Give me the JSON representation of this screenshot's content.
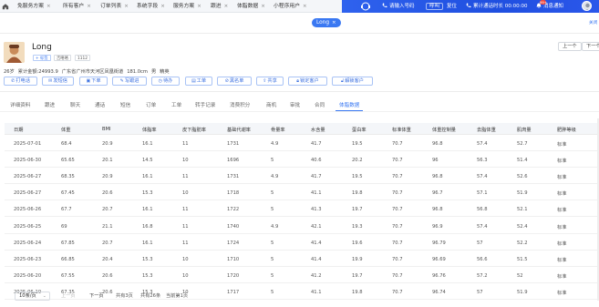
{
  "tabs": [
    {
      "label": "免服务方案"
    },
    {
      "label": "所有客户"
    },
    {
      "label": "订单列表"
    },
    {
      "label": "系统字段"
    },
    {
      "label": "服务方案"
    },
    {
      "label": "跟进"
    },
    {
      "label": "体脂数据"
    },
    {
      "label": "小程序用户"
    },
    {
      "label": "Long"
    }
  ],
  "tab_close": "×",
  "header": {
    "phone_label": "请输入号码",
    "dial_label": "呼叫",
    "reset_label": "复位",
    "call_duration": "累计通话时长 00:00:00",
    "messages_label": "消息通知",
    "message_count": "99+",
    "more_label": "关闭"
  },
  "customer": {
    "name": "Long",
    "tag_add": "+ 标签",
    "tag_1": "吉咯咯",
    "tag_2": "1112",
    "age": "26岁",
    "spent": "累计金额:24993.9",
    "address": "广东省广州市天河区凤凰街道",
    "height": "181.0cm",
    "gender": "男",
    "type": "精英"
  },
  "nav": {
    "prev": "上一个",
    "next": "下一个"
  },
  "actions": [
    {
      "label": "打电话",
      "icon": "phone-icon"
    },
    {
      "label": "发短信",
      "icon": "message-icon"
    },
    {
      "label": "下单",
      "icon": "cart-icon"
    },
    {
      "label": "写跟进",
      "icon": "edit-icon"
    },
    {
      "label": "待办",
      "icon": "todo-icon"
    },
    {
      "label": "工单",
      "icon": "ticket-icon"
    },
    {
      "label": "黑名单",
      "icon": "blacklist-icon"
    },
    {
      "label": "共享",
      "icon": "share-icon"
    },
    {
      "label": "锁定客户",
      "icon": "lock-icon"
    },
    {
      "label": "解锁客户",
      "icon": "unlock-icon"
    }
  ],
  "subtabs": [
    "详细资料",
    "跟进",
    "聊天",
    "通话",
    "短信",
    "订单",
    "工单",
    "转手记录",
    "消费积分",
    "商机",
    "审批",
    "合同",
    "体脂数据"
  ],
  "table": {
    "columns": [
      "日期",
      "体重",
      "BMI",
      "体脂率",
      "皮下脂肪率",
      "基础代谢率",
      "骨量率",
      "水含量",
      "蛋白率",
      "标准体重",
      "体重控制量",
      "去脂体重",
      "肌肉量",
      "肥胖等级"
    ],
    "rows": [
      [
        "2025-07-01",
        "68.4",
        "20.9",
        "16.1",
        "11",
        "1731",
        "4.9",
        "41.7",
        "19.5",
        "70.7",
        "96.8",
        "57.4",
        "52.7",
        "标准"
      ],
      [
        "2025-06-30",
        "65.65",
        "20.1",
        "14.5",
        "10",
        "1696",
        "5",
        "40.6",
        "20.2",
        "70.7",
        "96",
        "56.3",
        "51.4",
        "标准"
      ],
      [
        "2025-06-27",
        "68.35",
        "20.9",
        "16.1",
        "11",
        "1731",
        "4.9",
        "41.7",
        "19.5",
        "70.7",
        "96.8",
        "57.4",
        "52.6",
        "标准"
      ],
      [
        "2025-06-27",
        "67.45",
        "20.6",
        "15.3",
        "10",
        "1718",
        "5",
        "41.1",
        "19.8",
        "70.7",
        "96.7",
        "57.1",
        "51.9",
        "标准"
      ],
      [
        "2025-06-26",
        "67.7",
        "20.7",
        "16.1",
        "11",
        "1722",
        "5",
        "41.3",
        "19.7",
        "70.7",
        "96.8",
        "56.8",
        "52.1",
        "标准"
      ],
      [
        "2025-06-25",
        "69",
        "21.1",
        "16.8",
        "11",
        "1740",
        "4.9",
        "42.1",
        "19.3",
        "70.7",
        "96.9",
        "57.4",
        "52.4",
        "标准"
      ],
      [
        "2025-06-24",
        "67.85",
        "20.7",
        "16.1",
        "11",
        "1724",
        "5",
        "41.4",
        "19.6",
        "70.7",
        "96.79",
        "57",
        "52.2",
        "标准"
      ],
      [
        "2025-06-23",
        "66.85",
        "20.4",
        "15.3",
        "10",
        "1710",
        "5",
        "41.4",
        "19.9",
        "70.7",
        "96.69",
        "56.6",
        "51.5",
        "标准"
      ],
      [
        "2025-06-20",
        "67.55",
        "20.6",
        "15.3",
        "10",
        "1720",
        "5",
        "41.2",
        "19.7",
        "70.7",
        "96.76",
        "57.2",
        "52",
        "标准"
      ],
      [
        "2025-06-19",
        "67.35",
        "20.6",
        "15.3",
        "10",
        "1717",
        "5",
        "41.1",
        "19.8",
        "70.7",
        "96.74",
        "57",
        "51.9",
        "标准"
      ]
    ]
  },
  "pagination": {
    "page_size": "10条/页",
    "prev": "上一页",
    "next": "下一页",
    "pages": "共有3页",
    "total": "共有26条",
    "current": "当前第1页"
  },
  "colors": {
    "accent": "#3a78f2",
    "header_blue": "#2f62ee"
  }
}
